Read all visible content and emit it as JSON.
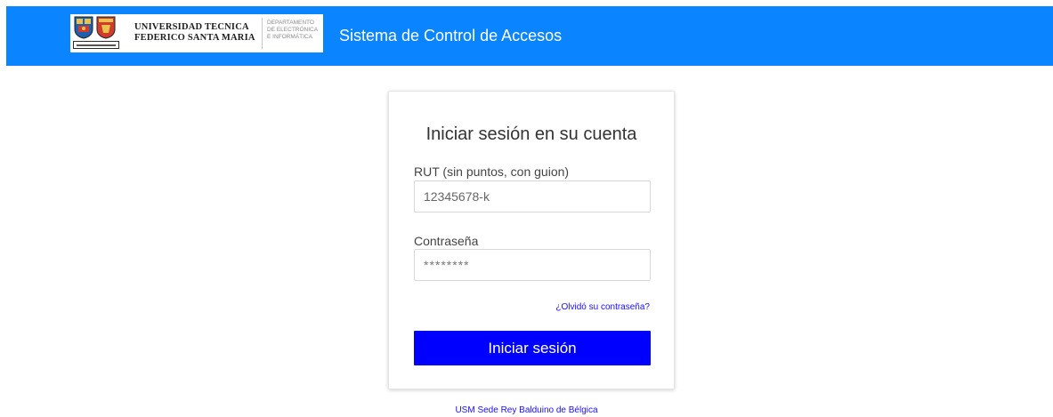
{
  "header": {
    "university_line1": "UNIVERSIDAD TECNICA",
    "university_line2": "FEDERICO SANTA MARIA",
    "department_line1": "DEPARTAMENTO",
    "department_line2": "DE ELECTRÓNICA",
    "department_line3": "E INFORMÁTICA",
    "app_title": "Sistema de Control de Accesos",
    "logo_icon": "university-crest-icon"
  },
  "login": {
    "title": "Iniciar sesión en su cuenta",
    "rut_label": "RUT (sin puntos, con guion)",
    "rut_placeholder": "12345678-k",
    "password_label": "Contraseña",
    "password_placeholder": "********",
    "forgot_link": "¿Olvidó su contraseña?",
    "submit_label": "Iniciar sesión"
  },
  "footer": {
    "link_text": "USM Sede Rey Balduino de Bélgica"
  },
  "colors": {
    "navbar": "#0a84ff",
    "button": "#0000ff",
    "link": "#1a0dff"
  }
}
